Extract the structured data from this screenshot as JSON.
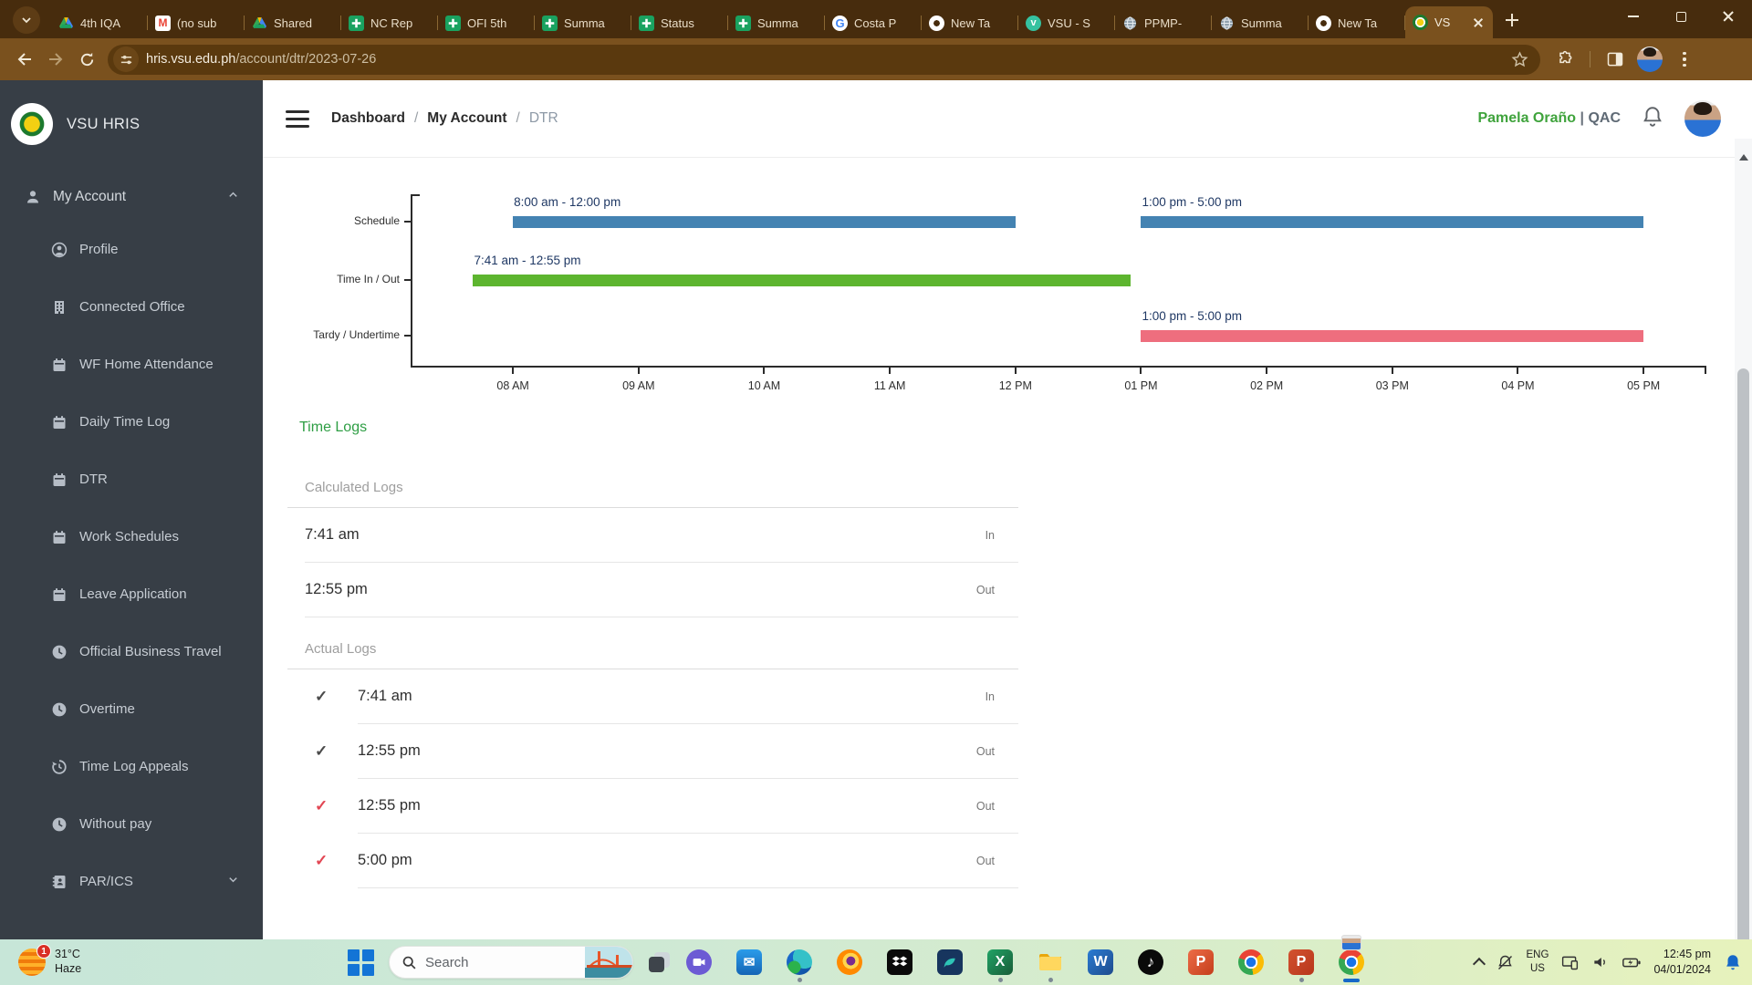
{
  "colors": {
    "accent_green": "#2e9e44",
    "name_green": "#3fa33c",
    "bar_blue": "#4483b2",
    "bar_green": "#5db52f",
    "bar_red": "#ee6e7e",
    "bar_label_navy": "#1f3864",
    "check_dark": "#4a4a4a",
    "check_red": "#e24653"
  },
  "browser": {
    "tabs": [
      {
        "icon": "drive",
        "label": "4th IQA"
      },
      {
        "icon": "gmail",
        "label": "(no sub"
      },
      {
        "icon": "drive",
        "label": "Shared"
      },
      {
        "icon": "sheets",
        "label": "NC Rep"
      },
      {
        "icon": "sheets",
        "label": "OFI 5th"
      },
      {
        "icon": "sheets",
        "label": "Summa"
      },
      {
        "icon": "sheets",
        "label": "Status"
      },
      {
        "icon": "sheets",
        "label": "Summa"
      },
      {
        "icon": "google",
        "label": "Costa P"
      },
      {
        "icon": "chrome",
        "label": "New Ta"
      },
      {
        "icon": "vfav",
        "label": "VSU - S"
      },
      {
        "icon": "globe",
        "label": "PPMP-"
      },
      {
        "icon": "globe",
        "label": "Summa"
      },
      {
        "icon": "chrome",
        "label": "New Ta"
      },
      {
        "icon": "vsu",
        "label": "VS",
        "active": true
      }
    ],
    "url_domain": "hris.vsu.edu.ph",
    "url_path": "/account/dtr/2023-07-26"
  },
  "sidebar": {
    "brand": "VSU HRIS",
    "section": {
      "icon": "person",
      "label": "My Account",
      "expanded": true
    },
    "items": [
      {
        "icon": "person-circle",
        "label": "Profile"
      },
      {
        "icon": "building",
        "label": "Connected Office"
      },
      {
        "icon": "calendar",
        "label": "WF Home Attendance"
      },
      {
        "icon": "calendar",
        "label": "Daily Time Log"
      },
      {
        "icon": "calendar",
        "label": "DTR"
      },
      {
        "icon": "calendar",
        "label": "Work Schedules"
      },
      {
        "icon": "calendar",
        "label": "Leave Application"
      },
      {
        "icon": "clock",
        "label": "Official Business Travel"
      },
      {
        "icon": "clock",
        "label": "Overtime"
      },
      {
        "icon": "history",
        "label": "Time Log Appeals"
      },
      {
        "icon": "clock",
        "label": "Without pay"
      },
      {
        "icon": "idcard",
        "label": "PAR/ICS",
        "expandable": true
      }
    ]
  },
  "header": {
    "crumbs": [
      {
        "label": "Dashboard"
      },
      {
        "label": "My Account"
      },
      {
        "label": "DTR",
        "current": true
      }
    ],
    "user_name": "Pamela Oraño",
    "user_sep": "|",
    "user_org": "QAC"
  },
  "chart_data": {
    "type": "gantt",
    "x_range_hours": [
      7.2,
      17.5
    ],
    "x_ticks": [
      {
        "label": "08 AM",
        "hour": 8
      },
      {
        "label": "09 AM",
        "hour": 9
      },
      {
        "label": "10 AM",
        "hour": 10
      },
      {
        "label": "11 AM",
        "hour": 11
      },
      {
        "label": "12 PM",
        "hour": 12
      },
      {
        "label": "01 PM",
        "hour": 13
      },
      {
        "label": "02 PM",
        "hour": 14
      },
      {
        "label": "03 PM",
        "hour": 15
      },
      {
        "label": "04 PM",
        "hour": 16
      },
      {
        "label": "05 PM",
        "hour": 17
      }
    ],
    "rows": [
      {
        "label": "Schedule",
        "color": "#4483b2",
        "segments": [
          {
            "label": "8:00 am - 12:00 pm",
            "start_hour": 8,
            "end_hour": 12
          },
          {
            "label": "1:00 pm - 5:00 pm",
            "start_hour": 13,
            "end_hour": 17
          }
        ]
      },
      {
        "label": "Time In / Out",
        "color": "#5db52f",
        "segments": [
          {
            "label": "7:41 am - 12:55 pm",
            "start_hour": 7.683,
            "end_hour": 12.917
          }
        ]
      },
      {
        "label": "Tardy / Undertime",
        "color": "#ee6e7e",
        "segments": [
          {
            "label": "1:00 pm - 5:00 pm",
            "start_hour": 13,
            "end_hour": 17
          }
        ]
      }
    ]
  },
  "time_logs": {
    "title": "Time Logs",
    "calculated": {
      "heading": "Calculated Logs",
      "rows": [
        {
          "time": "7:41 am",
          "direction": "In"
        },
        {
          "time": "12:55 pm",
          "direction": "Out"
        }
      ]
    },
    "actual": {
      "heading": "Actual Logs",
      "rows": [
        {
          "time": "7:41 am",
          "direction": "In",
          "check_color": "#4a4a4a"
        },
        {
          "time": "12:55 pm",
          "direction": "Out",
          "check_color": "#4a4a4a"
        },
        {
          "time": "12:55 pm",
          "direction": "Out",
          "check_color": "#e24653"
        },
        {
          "time": "5:00 pm",
          "direction": "Out",
          "check_color": "#e24653"
        }
      ]
    }
  },
  "taskbar": {
    "weather": {
      "badge": "1",
      "temp": "31°C",
      "condition": "Haze"
    },
    "search": {
      "placeholder": "Search"
    },
    "apps": [
      {
        "name": "video-chat-app",
        "kind": "a-chat"
      },
      {
        "name": "mail-app",
        "kind": "a-mail",
        "glyph": "✉"
      },
      {
        "name": "edge-browser",
        "kind": "a-edge",
        "running": true
      },
      {
        "name": "firefox-browser",
        "kind": "a-firefox"
      },
      {
        "name": "dropbox-app",
        "kind": "a-dropbox"
      },
      {
        "name": "dev-app",
        "kind": "a-devapp"
      },
      {
        "name": "excel-app",
        "kind": "a-excel",
        "glyph": "X",
        "running": true
      },
      {
        "name": "file-explorer",
        "kind": "a-folder",
        "running": true
      },
      {
        "name": "word-app",
        "kind": "a-word",
        "glyph": "W"
      },
      {
        "name": "tiktok-app",
        "kind": "a-tiktok",
        "glyph": "♪"
      },
      {
        "name": "powerpoint-app",
        "kind": "a-ppt",
        "glyph": "P"
      },
      {
        "name": "chrome-browser",
        "kind": "a-chrome"
      },
      {
        "name": "powerpoint-app-2",
        "kind": "a-ppt2",
        "glyph": "P",
        "running": true
      },
      {
        "name": "chrome-browser-active",
        "kind": "a-chrome-active",
        "active": true,
        "thumbnail": true
      }
    ],
    "tray": {
      "lang_top": "ENG",
      "lang_bottom": "US",
      "time": "12:45 pm",
      "date": "04/01/2024"
    }
  }
}
